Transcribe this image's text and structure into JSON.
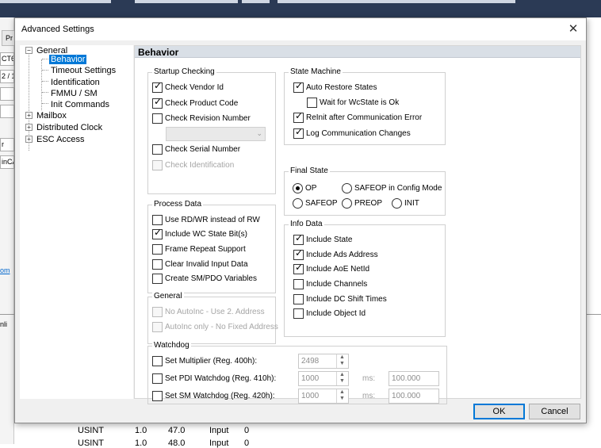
{
  "dialog": {
    "title": "Advanced Settings",
    "close_glyph": "✕"
  },
  "tree": {
    "general": "General",
    "behavior": "Behavior",
    "timeout": "Timeout Settings",
    "identification": "Identification",
    "fmmu": "FMMU / SM",
    "init": "Init Commands",
    "mailbox": "Mailbox",
    "dc": "Distributed Clock",
    "esc": "ESC Access",
    "expand_minus": "−",
    "expand_plus": "+"
  },
  "panel": {
    "header": "Behavior",
    "startup": {
      "title": "Startup Checking",
      "vendor": "Check Vendor Id",
      "product": "Check Product Code",
      "revision": "Check Revision Number",
      "serial": "Check Serial Number",
      "ident": "Check Identification",
      "combo_arrow": "⌄"
    },
    "process": {
      "title": "Process Data",
      "rdwr": "Use RD/WR instead of RW",
      "wc": "Include WC State Bit(s)",
      "frame": "Frame Repeat Support",
      "clear": "Clear Invalid Input Data",
      "create": "Create SM/PDO Variables"
    },
    "general": {
      "title": "General",
      "noauto": "No AutoInc - Use 2. Address",
      "autoonly": "AutoInc only - No Fixed Address"
    },
    "state_machine": {
      "title": "State Machine",
      "auto_restore": "Auto Restore States",
      "wait_wc": "Wait for WcState is Ok",
      "reinit": "ReInit after Communication Error",
      "log": "Log Communication Changes"
    },
    "final_state": {
      "title": "Final State",
      "op": "OP",
      "safeop_cfg": "SAFEOP in Config Mode",
      "safeop": "SAFEOP",
      "preop": "PREOP",
      "init": "INIT"
    },
    "info": {
      "title": "Info Data",
      "state": "Include State",
      "ads": "Include Ads Address",
      "aoe": "Include AoE NetId",
      "channels": "Include Channels",
      "dc_shift": "Include DC Shift Times",
      "object": "Include Object Id"
    },
    "watchdog": {
      "title": "Watchdog",
      "multiplier": "Set Multiplier (Reg. 400h):",
      "pdi": "Set PDI Watchdog (Reg. 410h):",
      "sm": "Set SM Watchdog (Reg. 420h):",
      "multiplier_value": "2498",
      "pdi_value": "1000",
      "sm_value": "1000",
      "unit": "ms:",
      "pdi_ms": "100.000",
      "sm_ms": "100.000",
      "spin_up": "▲",
      "spin_down": "▼"
    }
  },
  "buttons": {
    "ok": "OK",
    "cancel": "Cancel"
  },
  "background": {
    "tab_label": "Pr",
    "field1": "CT6",
    "field2": "2 / 1",
    "field3": "r",
    "field4": "inCA",
    "link": "om",
    "onli": "nli",
    "rows": [
      {
        "type": "USINT",
        "size": "1.0",
        "offset": "47.0",
        "dir": "Input",
        "val": "0"
      },
      {
        "type": "USINT",
        "size": "1.0",
        "offset": "48.0",
        "dir": "Input",
        "val": "0"
      }
    ]
  }
}
